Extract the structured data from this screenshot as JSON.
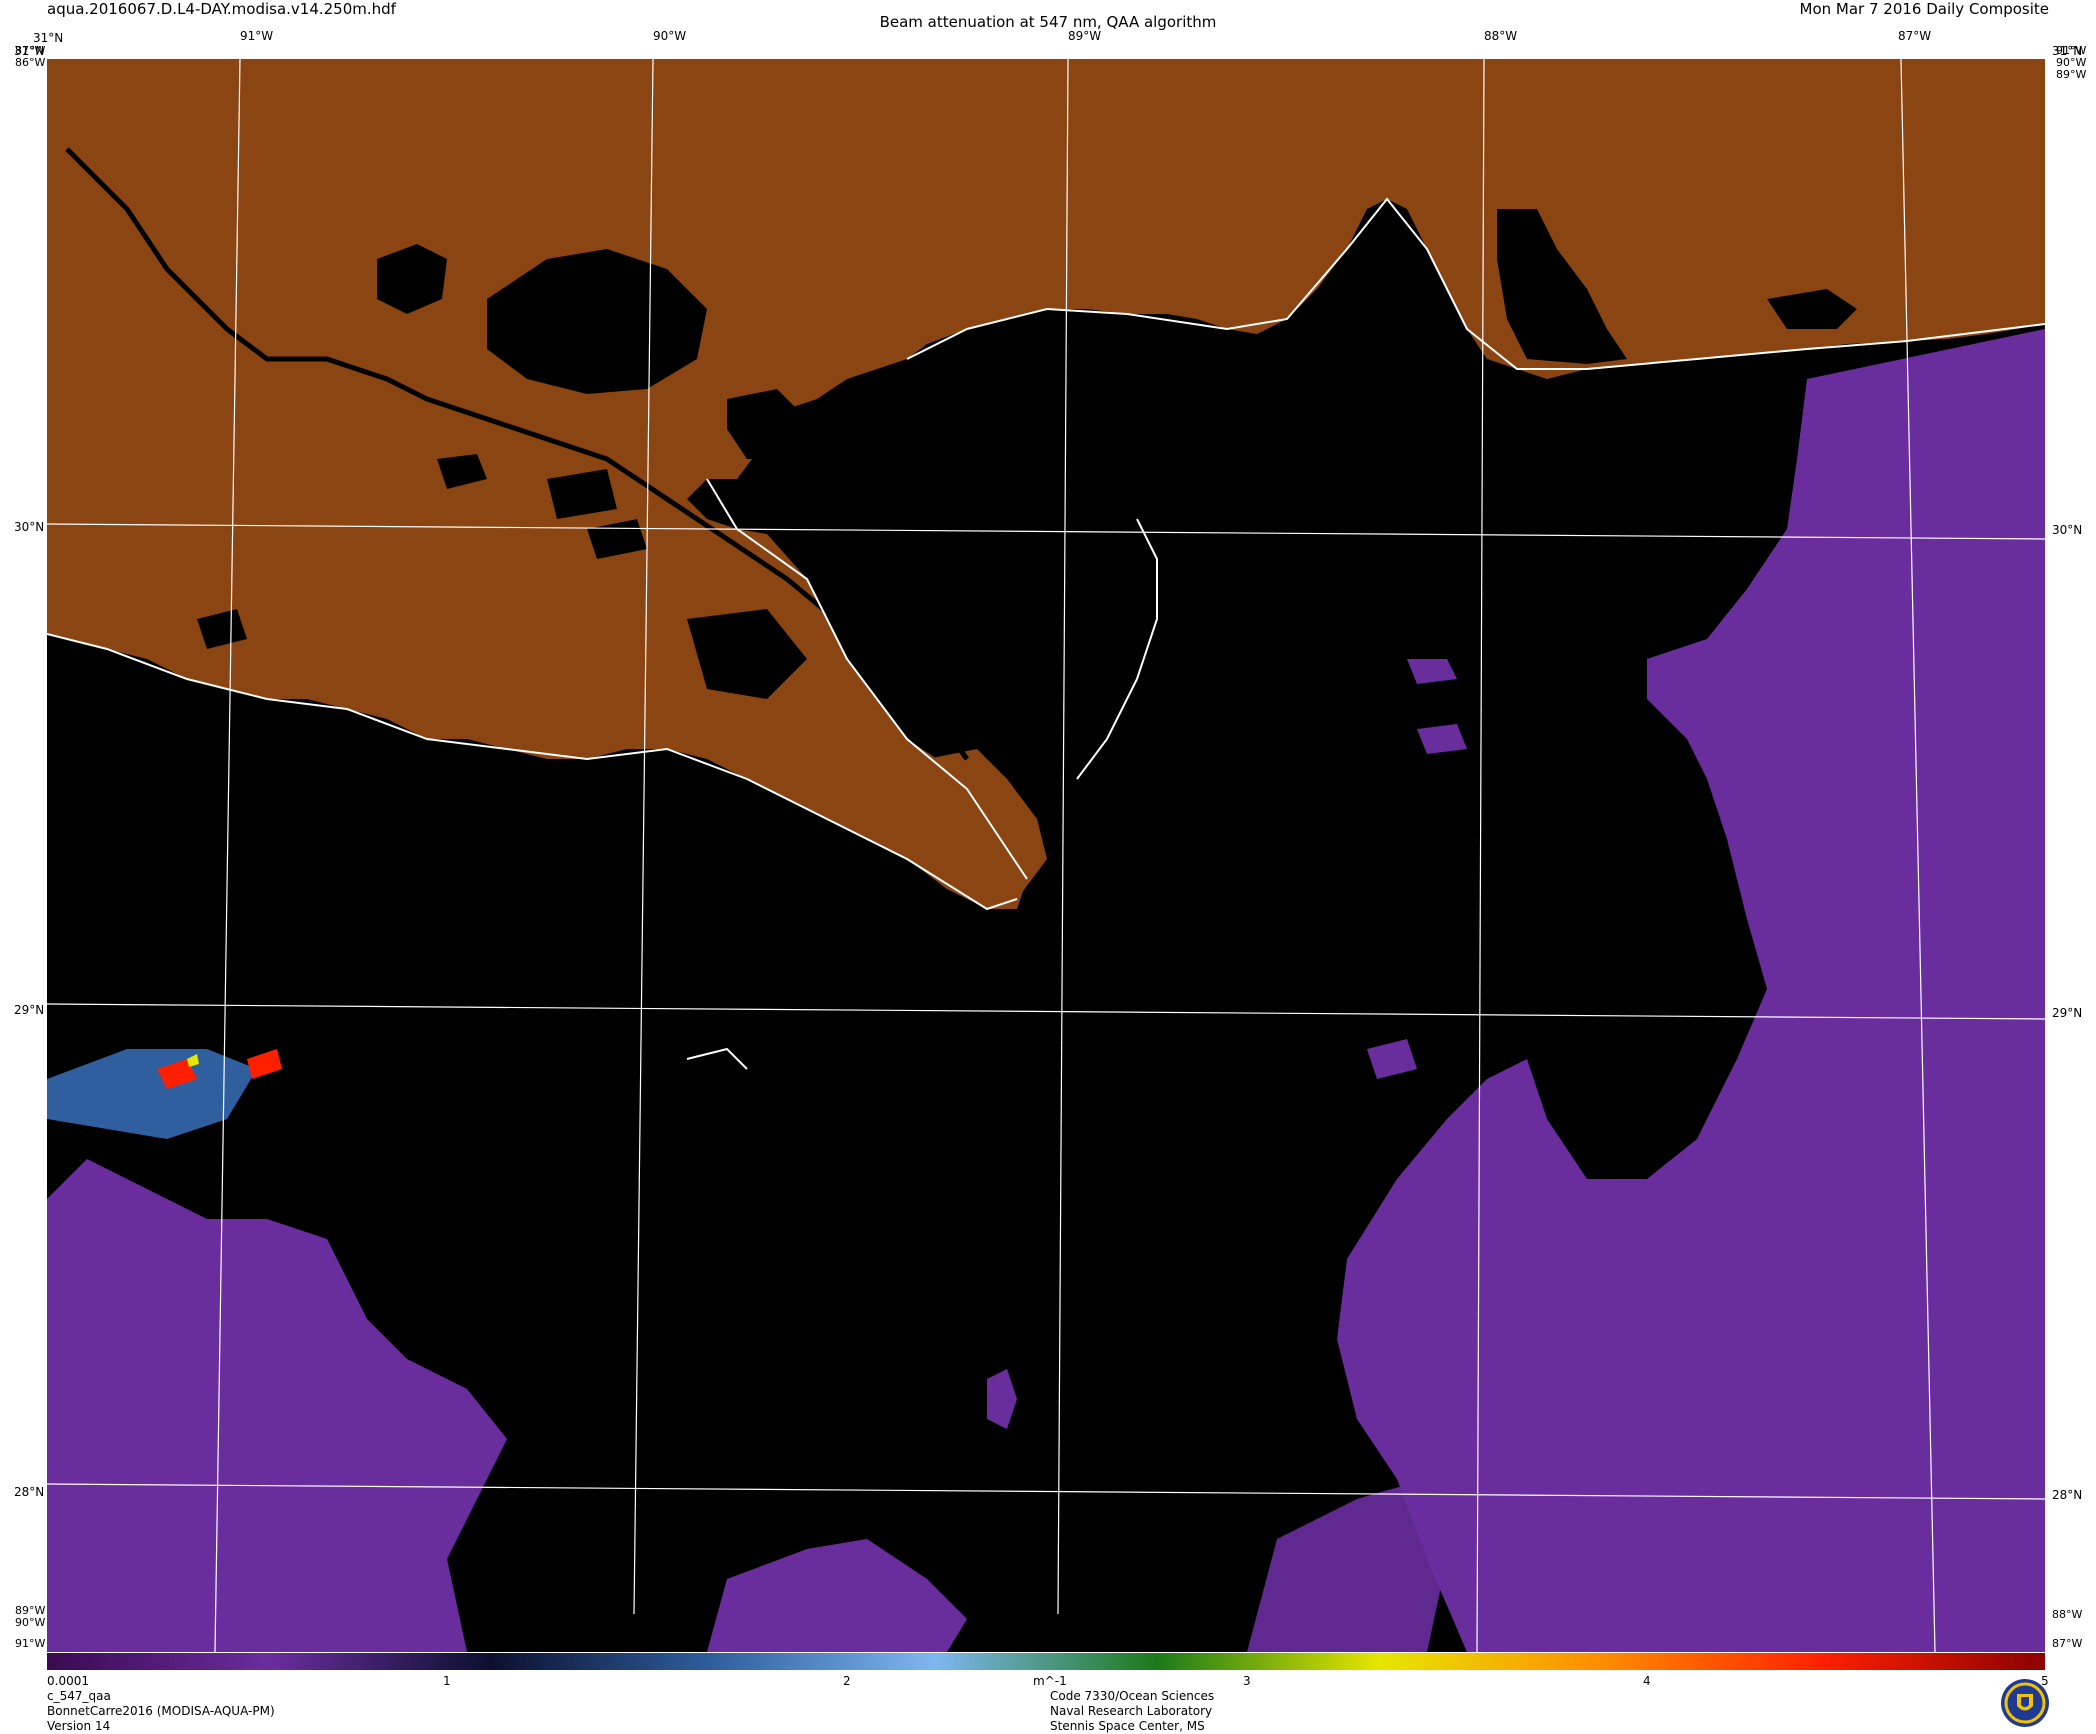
{
  "header": {
    "filename": "aqua.2016067.D.L4-DAY.modisa.v14.250m.hdf",
    "title": "Beam attenuation at 547 nm, QAA algorithm",
    "date": "Mon Mar  7 2016 Daily Composite"
  },
  "map": {
    "top_lon_labels": [
      "91°W",
      "90°W",
      "89°W",
      "88°W",
      "87°W"
    ],
    "left_lat_labels": [
      "31°N",
      "30°N",
      "29°N",
      "28°N"
    ],
    "right_lat_labels": [
      "31°N",
      "30°N",
      "29°N",
      "28°N"
    ],
    "corner_labels": {
      "top_left_lat": "31°N",
      "top_left_a": "87°W",
      "top_left_b": "86°W",
      "top_right_a": "91°W",
      "top_right_b": "90°W",
      "top_right_c": "89°W",
      "bottom_left_a": "89°W",
      "bottom_left_b": "90°W",
      "bottom_left_c": "91°W",
      "bottom_right_a": "88°W",
      "bottom_right_b": "87°W"
    },
    "colors": {
      "land": "#8b4513",
      "water_nodata": "#000000",
      "coastline": "#ffffff",
      "grid": "#ffffff",
      "low_attenuation": "#6a2d9e"
    }
  },
  "colorbar": {
    "min_label": "0.0001",
    "tick_labels": [
      "1",
      "2",
      "3",
      "4",
      "5"
    ],
    "unit": "m^-1",
    "colors": [
      "#3a0a52",
      "#6a2d9e",
      "#0b1030",
      "#2f5f9e",
      "#7fb6f0",
      "#1a7a1a",
      "#e6e600",
      "#ff8c00",
      "#ff2000",
      "#8b0000"
    ]
  },
  "footer": {
    "left": [
      "c_547_qaa",
      "BonnetCarre2016 (MODISA-AQUA-PM)",
      "Version 14"
    ],
    "center": [
      "Code 7330/Ocean Sciences",
      "Naval Research Laboratory",
      "Stennis Space Center, MS"
    ]
  }
}
